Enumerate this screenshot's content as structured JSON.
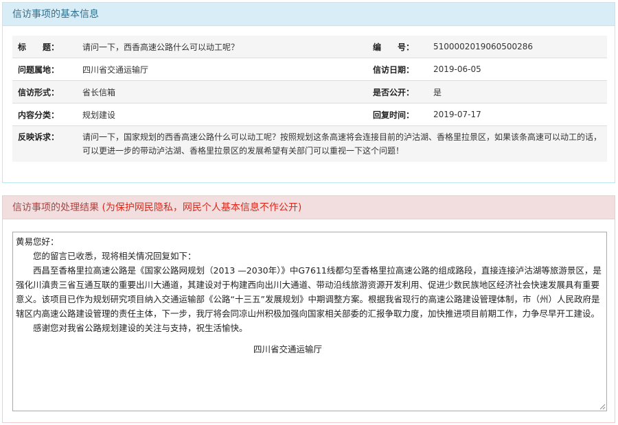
{
  "info_panel": {
    "title": "信访事项的基本信息",
    "rows": [
      {
        "label": "标　　题：",
        "value": "请问一下，西香高速公路什么可以动工呢？",
        "label2": "编　　号：",
        "value2": "5100002019060500286"
      },
      {
        "label": "问题属地：",
        "value": "四川省交通运输厅",
        "label2": "信访日期：",
        "value2": "2019-06-05"
      },
      {
        "label": "信访形式：",
        "value": "省长信箱",
        "label2": "是否公开：",
        "value2": "是"
      },
      {
        "label": "内容分类：",
        "value": "规划建设",
        "label2": "回复时间：",
        "value2": "2019-07-17"
      }
    ],
    "complaint": {
      "label": "反映诉求：",
      "value": "请问一下，国家规划的西香高速公路什么可以动工呢？按照规划这条高速将会连接目前的泸沽湖、香格里拉景区，如果该条高速可以动工的话，可以更进一步的带动泸沽湖、香格里拉景区的发展希望有关部门可以重视一下这个问题！"
    }
  },
  "result_panel": {
    "title": "信访事项的处理结果",
    "privacy_note": "(为保护网民隐私，网民个人基本信息不作公开)",
    "reply": {
      "greeting": "黄易您好：",
      "p1": "您的留言已收悉，现将相关情况回复如下：",
      "p2": "西昌至香格里拉高速公路是《国家公路网规划（2013 —2030年）》中G7611线都匀至香格里拉高速公路的组成路段，直接连接泸沽湖等旅游景区，是强化川滇贵三省互通互联的重要出川大通道，其建设对于构建西向出川大通道、带动沿线旅游资源开发利用、促进少数民族地区经济社会快速发展具有重要意义。该项目已作为规划研究项目纳入交通运输部《公路“十三五”发展规划》中期调整方案。根据我省现行的高速公路建设管理体制，市（州）人民政府是辖区内高速公路建设管理的责任主体，下一步，我厅将会同凉山州积极加强向国家相关部委的汇报争取力度，加快推进项目前期工作，力争尽早开工建设。",
      "p3": "感谢您对我省公路规划建设的关注与支持，祝生活愉快。",
      "signature": "四川省交通运输厅"
    }
  }
}
